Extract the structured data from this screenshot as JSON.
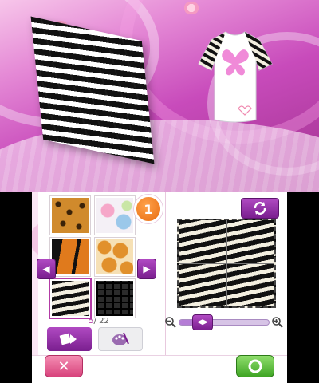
{
  "top_screen": {
    "decorations": [
      "fabric-swatch-3d",
      "tshirt-preview",
      "flower-icon"
    ]
  },
  "bottom_screen": {
    "badge": {
      "label": "1"
    },
    "swatches": [
      {
        "name": "leopard",
        "selected": false
      },
      {
        "name": "floral",
        "selected": false
      },
      {
        "name": "tiger",
        "selected": false
      },
      {
        "name": "giraffe",
        "selected": false
      },
      {
        "name": "zebra",
        "selected": true
      },
      {
        "name": "crocodile",
        "selected": false
      }
    ],
    "pager": {
      "current": "5",
      "separator": "/",
      "total": "22"
    },
    "icons": {
      "prev": "chevron-left-icon",
      "next": "chevron-right-icon",
      "refresh": "refresh-icon",
      "zoom_out": "zoom-out-icon",
      "zoom_in": "zoom-in-icon",
      "pattern_mode": "pattern-mode-icon",
      "paint_mode": "palette-icon",
      "cancel": "close-icon",
      "confirm": "confirm-icon"
    },
    "zoom": {
      "level": 0.18
    },
    "buttons": {
      "cancel_glyph": "✕"
    },
    "colors": {
      "accent": "#8b2aa0",
      "cancel": "#e0528a",
      "confirm": "#55b83a",
      "badge": "#f07a1a"
    }
  }
}
